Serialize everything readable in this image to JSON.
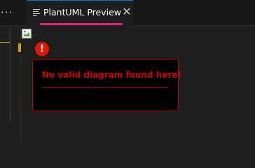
{
  "editor": {
    "overflow_label": "···",
    "tab": {
      "title": "PlantUML Preview",
      "close_glyph": "✕",
      "icon": "preview-lines-icon"
    }
  },
  "preview": {
    "broken_image_icon": "broken-image-icon",
    "error_glyph": "!",
    "error_message": "No valid diagram found here!"
  },
  "colors": {
    "accent": "#e0257a",
    "error": "#e51400",
    "active_tab_border": "#0078d4"
  }
}
